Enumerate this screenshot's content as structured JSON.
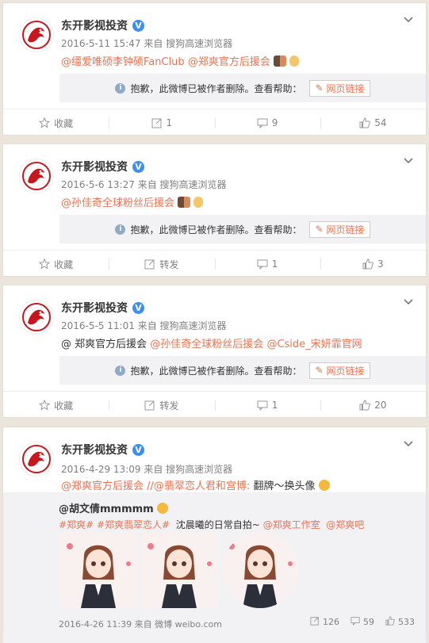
{
  "author": {
    "name": "东开影视投资",
    "verified_mark": "V"
  },
  "posts": [
    {
      "meta_date": "2016-5-11 15:47",
      "meta_from": "来自",
      "meta_source": "搜狗高速浏览器",
      "mentions": [
        "@缰爱唯硕李钟硕FanClub",
        "@郑爽官方后援会"
      ],
      "deleted_text": "抱歉，此微博已被作者删除。查看帮助：",
      "weblink_label": "网页链接",
      "collect": "收藏",
      "forward": "1",
      "comment": "9",
      "like": "54"
    },
    {
      "meta_date": "2016-5-6 13:27",
      "meta_from": "来自",
      "meta_source": "搜狗高速浏览器",
      "mentions": [
        "@孙佳奇全球粉丝后援会"
      ],
      "deleted_text": "抱歉，此微博已被作者删除。查看帮助：",
      "weblink_label": "网页链接",
      "collect": "收藏",
      "forward": "转发",
      "comment": "1",
      "like": "3"
    },
    {
      "meta_date": "2016-5-5 11:01",
      "meta_from": "来自",
      "meta_source": "搜狗高速浏览器",
      "content_prefix": "@ 郑爽官方后援会",
      "mentions": [
        "@孙佳奇全球粉丝后援会",
        "@Cside_宋妍霏官网"
      ],
      "deleted_text": "抱歉，此微博已被作者删除。查看帮助：",
      "weblink_label": "网页链接",
      "collect": "收藏",
      "forward": "转发",
      "comment": "1",
      "like": "20"
    },
    {
      "meta_date": "2016-4-29 13:09",
      "meta_from": "来自",
      "meta_source": "搜狗高速浏览器",
      "mentions": [
        "@郑爽官方后援会",
        "//@翡翠恋人君和宫博:"
      ],
      "content_suffix": "翻牌～换头像",
      "fwd_author": "@胡文倩mmmmm",
      "topics": [
        "#郑爽#",
        "#郑爽翡翠恋人#"
      ],
      "fwd_text": "沈晨曦的日常自拍~",
      "fwd_mentions": [
        "@郑爽工作室",
        "@郑爽吧"
      ],
      "fwd_footer": "2016-4-26 11:39 来自 微博 weibo.com",
      "fwd_forward": "126",
      "fwd_comment": "59",
      "fwd_like": "533"
    }
  ],
  "colors": {
    "link": "#eb7350",
    "verified": "#3a8ff0",
    "background": "#ebe5dc"
  }
}
